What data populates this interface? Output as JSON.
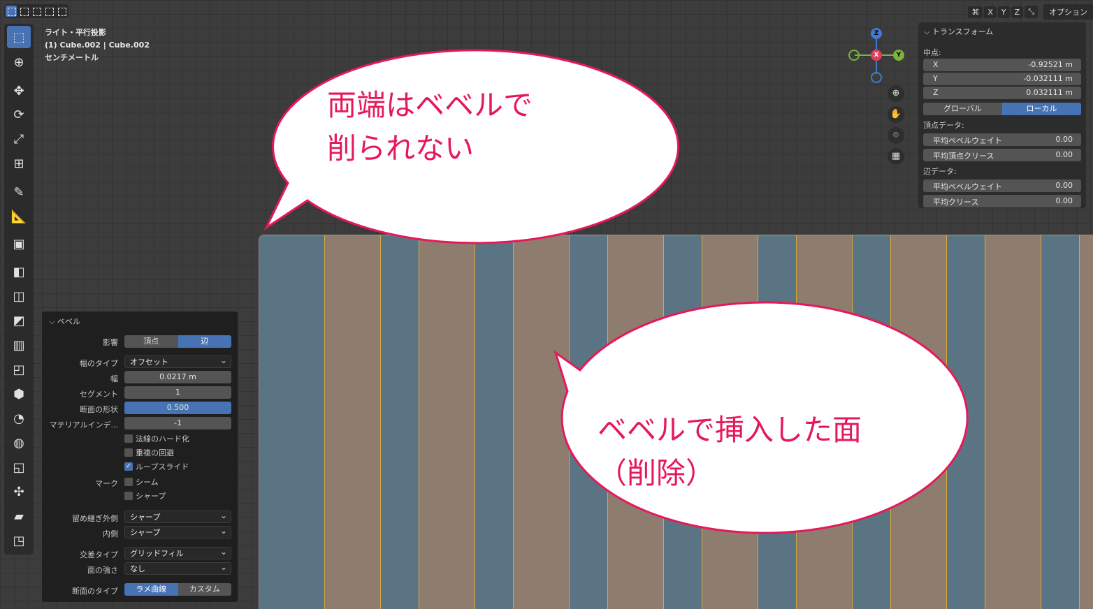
{
  "info": {
    "view": "ライト・平行投影",
    "object": "(1) Cube.002 | Cube.002",
    "unit": "センチメートル"
  },
  "gizmo": {
    "x": "X",
    "y": "Y",
    "z": "Z"
  },
  "header_right": {
    "x": "X",
    "y": "Y",
    "z": "Z",
    "options": "オプション"
  },
  "transform": {
    "title": "トランスフォーム",
    "median_label": "中点:",
    "x_label": "X",
    "x_value": "-0.92521 m",
    "y_label": "Y",
    "y_value": "-0.032111 m",
    "z_label": "Z",
    "z_value": "0.032111 m",
    "global": "グローバル",
    "local": "ローカル",
    "vertex_data": "頂点データ:",
    "v_bevel_weight": "平均ベベルウェイト",
    "v_bevel_weight_value": "0.00",
    "v_crease": "平均頂点クリース",
    "v_crease_value": "0.00",
    "edge_data": "辺データ:",
    "e_bevel_weight": "平均ベベルウェイト",
    "e_bevel_weight_value": "0.00",
    "e_crease": "平均クリース",
    "e_crease_value": "0.00"
  },
  "bevel": {
    "title": "ベベル",
    "affect_label": "影響",
    "affect_vertex": "頂点",
    "affect_edge": "辺",
    "width_type_label": "幅のタイプ",
    "width_type": "オフセット",
    "width_label": "幅",
    "width": "0.0217 m",
    "segments_label": "セグメント",
    "segments": "1",
    "shape_label": "断面の形状",
    "shape": "0.500",
    "material_label": "マテリアルインデ...",
    "material": "-1",
    "harden_normals": "法線のハード化",
    "clamp_overlap": "重複の回避",
    "loop_slide": "ループスライド",
    "mark_label": "マーク",
    "seam": "シーム",
    "sharp": "シャープ",
    "miter_outer_label": "留め継ぎ外側",
    "miter_outer": "シャープ",
    "miter_inner_label": "内側",
    "miter_inner": "シャープ",
    "intersection_label": "交差タイプ",
    "intersection": "グリッドフィル",
    "face_strength_label": "面の強さ",
    "face_strength": "なし",
    "profile_type_label": "断面のタイプ",
    "profile_superellipse": "ラメ曲線",
    "profile_custom": "カスタム"
  },
  "callout1": {
    "line1": "両端はベベルで",
    "line2": "削られない"
  },
  "callout2": {
    "line1": "ベベルで挿入した面",
    "line2": "（削除）"
  },
  "colors": {
    "accent": "#4772b3",
    "callout": "#e5195a",
    "face_selected": "#8e7c6e",
    "face": "#5b7484"
  }
}
